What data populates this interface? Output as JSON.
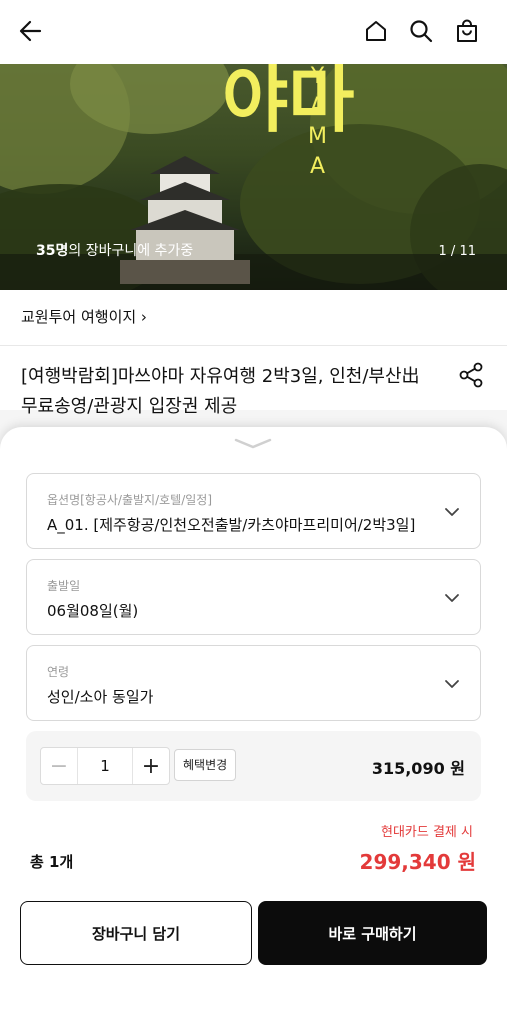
{
  "header": {
    "back_icon": "arrow-left-icon",
    "home_icon": "home-icon",
    "search_icon": "search-icon",
    "bag_icon": "shopping-bag-icon"
  },
  "hero": {
    "big_text": "야마",
    "vertical_text": "YAMA",
    "cart_count_bold": "35명",
    "cart_count_rest": "의 장바구니에 추가중",
    "pager": "1 / 11"
  },
  "seller": {
    "name": "교원투어 여행이지 ›"
  },
  "product": {
    "title": "[여행박람회]마쓰야마 자유여행 2박3일, 인천/부산出 무료송영/관광지 입장권 제공",
    "share_icon": "share-icon"
  },
  "options": [
    {
      "label": "옵션명[항공사/출발지/호텔/일정]",
      "value": "A_01. [제주항공/인천오전출발/카츠야마프리미어/2박3일]"
    },
    {
      "label": "출발일",
      "value": "06월08일(월)"
    },
    {
      "label": "연령",
      "value": "성인/소아 동일가"
    }
  ],
  "quantity": {
    "minus": "−",
    "value": "1",
    "plus": "+",
    "benefit_button": "혜택변경",
    "unit_price": "315,090 원"
  },
  "summary": {
    "card_note": "현대카드 결제 시",
    "total_label": "총 1개",
    "total_price": "299,340 원"
  },
  "actions": {
    "add_to_cart": "장바구니 담기",
    "buy_now": "바로 구매하기"
  },
  "colors": {
    "accent_red": "#e33a3a",
    "hero_yellow": "#f2ee5e",
    "buy_button": "#0c0c0c"
  }
}
